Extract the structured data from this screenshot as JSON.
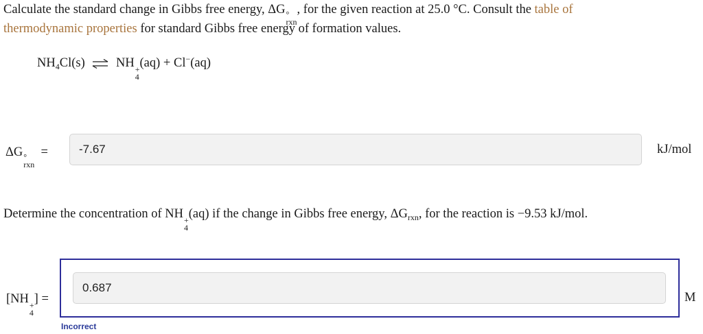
{
  "question1": {
    "text_a": "Calculate the standard change in Gibbs free energy, ",
    "text_b": ", for the given reaction at ",
    "temperature": "25.0 °C",
    "text_c": ". Consult the ",
    "link_line1": "table of",
    "link_line2": "thermodynamic properties",
    "text_d": " for standard Gibbs free energy of formation values."
  },
  "symbols": {
    "delta_g": "ΔG",
    "degree": "°",
    "rxn": "rxn",
    "equals": "="
  },
  "equation": {
    "reactant": "NH",
    "reactant_sub": "4",
    "reactant_rest": "Cl(s)",
    "product1": "NH",
    "product1_sup": "+",
    "product1_sub": "4",
    "product1_state": "(aq)",
    "plus": "+",
    "product2": "Cl",
    "product2_sup": "−",
    "product2_state": "(aq)"
  },
  "answer1": {
    "value": "-7.67",
    "unit": "kJ/mol"
  },
  "question2": {
    "text_a": "Determine the concentration of NH",
    "sup": "+",
    "sub": "4",
    "text_b": "(aq) if the change in Gibbs free energy, ",
    "text_c": ", for the reaction is ",
    "value": "−9.53 kJ/mol",
    "text_d": "."
  },
  "answer2": {
    "label_open": "[NH",
    "label_sup": "+",
    "label_sub": "4",
    "label_close": "]",
    "value": "0.687",
    "unit": "M",
    "feedback": "Incorrect",
    "focus_color": "#2d2d9a"
  },
  "colors": {
    "link": "#a8743c",
    "feedback": "#2a3a99"
  }
}
